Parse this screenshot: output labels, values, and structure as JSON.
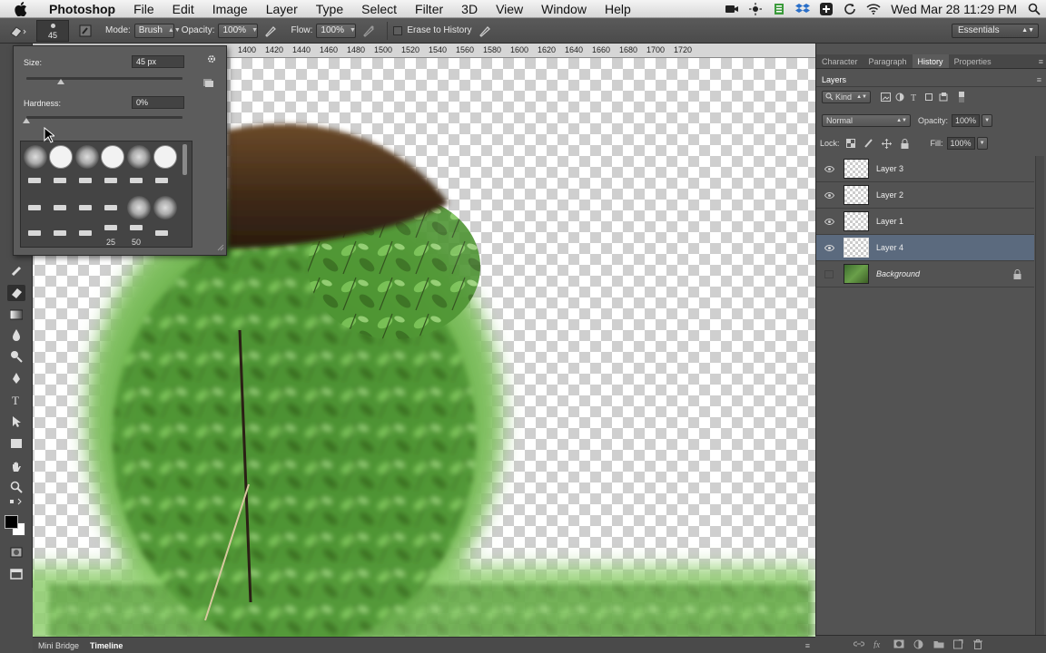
{
  "menubar": {
    "app_name": "Photoshop",
    "items": [
      "File",
      "Edit",
      "Image",
      "Layer",
      "Type",
      "Select",
      "Filter",
      "3D",
      "View",
      "Window",
      "Help"
    ],
    "clock": "Wed Mar 28  11:29 PM"
  },
  "options": {
    "brush_size_label": "45",
    "mode_label": "Mode:",
    "mode_value": "Brush",
    "opacity_label": "Opacity:",
    "opacity_value": "100%",
    "flow_label": "Flow:",
    "flow_value": "100%",
    "erase_history_label": "Erase to History",
    "workspace": "Essentials"
  },
  "ruler": {
    "ticks": [
      "1400",
      "1420",
      "1440",
      "1460",
      "1480",
      "1500",
      "1520",
      "1540",
      "1560",
      "1580",
      "1600",
      "1620",
      "1640",
      "1660",
      "1680",
      "1700",
      "1720"
    ]
  },
  "brush_picker": {
    "size_label": "Size:",
    "size_value": "45 px",
    "size_fraction": 0.22,
    "hardness_label": "Hardness:",
    "hardness_value": "0%",
    "hardness_fraction": 0.0,
    "tip_labels": [
      "25",
      "50"
    ]
  },
  "panels": {
    "tabs": [
      "Character",
      "Paragraph",
      "History",
      "Properties"
    ],
    "active_tab": "History",
    "layers_title": "Layers",
    "kind_label": "Kind",
    "blend_mode": "Normal",
    "opacity_label": "Opacity:",
    "opacity_value": "100%",
    "lock_label": "Lock:",
    "fill_label": "Fill:",
    "fill_value": "100%",
    "layers": [
      {
        "name": "Layer 3",
        "visible": true,
        "selected": false
      },
      {
        "name": "Layer 2",
        "visible": true,
        "selected": false
      },
      {
        "name": "Layer 1",
        "visible": true,
        "selected": false
      },
      {
        "name": "Layer 4",
        "visible": true,
        "selected": true
      },
      {
        "name": "Background",
        "visible": false,
        "selected": false,
        "locked": true
      }
    ]
  },
  "bottombar": {
    "tabs": [
      "Mini Bridge",
      "Timeline"
    ],
    "active": "Timeline"
  },
  "colors": {
    "selected_layer": "#5b6a7e",
    "panel_bg": "#535353",
    "foreground_swatch": "#000000",
    "background_swatch": "#ffffff"
  }
}
